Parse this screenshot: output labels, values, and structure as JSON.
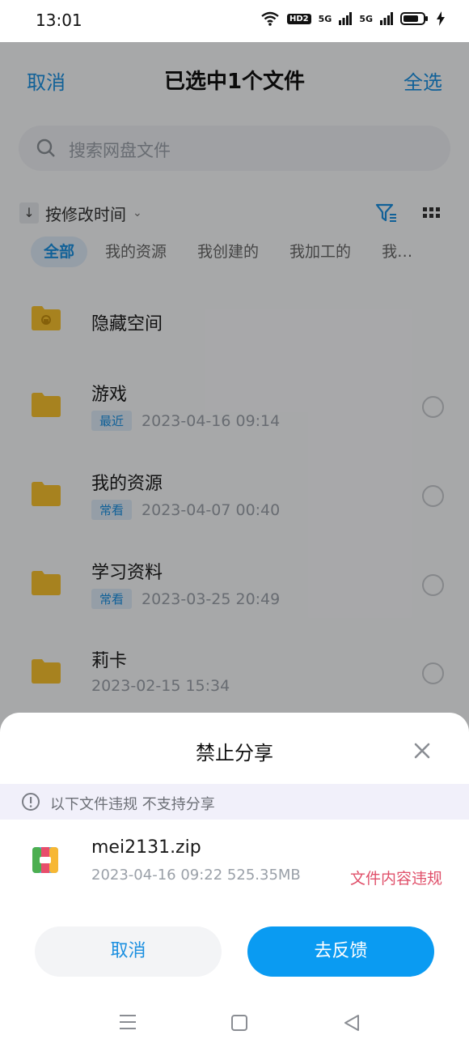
{
  "status": {
    "time": "13:01",
    "network1": "5G",
    "network2": "5G",
    "hd": "HD2"
  },
  "nav": {
    "cancel": "取消",
    "title": "已选中1个文件",
    "select_all": "全选"
  },
  "search": {
    "placeholder": "搜索网盘文件"
  },
  "sort": {
    "arrow": "↓",
    "label": "按修改时间",
    "chevron": "⌄"
  },
  "tabs": [
    "全部",
    "我的资源",
    "我创建的",
    "我加工的",
    "我…"
  ],
  "files": [
    {
      "name": "隐藏空间",
      "tag": "",
      "date": ""
    },
    {
      "name": "游戏",
      "tag": "最近",
      "date": "2023-04-16  09:14"
    },
    {
      "name": "我的资源",
      "tag": "常看",
      "date": "2023-04-07  00:40"
    },
    {
      "name": "学习资料",
      "tag": "常看",
      "date": "2023-03-25  20:49"
    },
    {
      "name": "莉卡",
      "tag": "",
      "date": "2023-02-15  15:34"
    }
  ],
  "sheet": {
    "title": "禁止分享",
    "warning": "以下文件违规 不支持分享",
    "file_name": "mei2131.zip",
    "file_meta": "2023-04-16  09:22   525.35MB",
    "violation": "文件内容违规",
    "cancel_button": "取消",
    "feedback_button": "去反馈"
  },
  "colors": {
    "accent": "#1a8fe0",
    "primary_button": "#0a9bf2",
    "violation": "#e0506a",
    "folder": "#f6c02e"
  }
}
